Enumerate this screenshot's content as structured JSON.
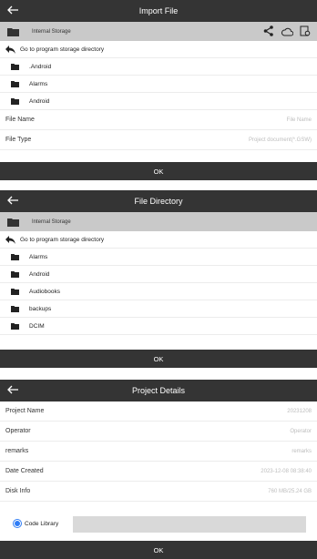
{
  "import_file": {
    "title": "Import File",
    "storage": "Internal Storage",
    "goto": "Go to program storage directory",
    "folders": [
      ".Android",
      "Alarms",
      "Android"
    ],
    "fields": [
      {
        "key": "File Name",
        "value": "File Name"
      },
      {
        "key": "File Type",
        "value": "Project document(*.GSW)"
      }
    ],
    "ok": "OK",
    "icons": [
      "back-arrow-icon",
      "folder-icon",
      "share-icon",
      "cloud-icon",
      "settings-file-icon",
      "goto-icon"
    ]
  },
  "file_directory": {
    "title": "File Directory",
    "storage": "Internal Storage",
    "goto": "Go to program storage directory",
    "folders": [
      "Alarms",
      "Android",
      "Audiobooks",
      "backups",
      "DCIM"
    ],
    "ok": "OK"
  },
  "project_details": {
    "title": "Project Details",
    "fields": [
      {
        "key": "Project Name",
        "value": "20231208"
      },
      {
        "key": "Operator",
        "value": "Operator"
      },
      {
        "key": "remarks",
        "value": "remarks"
      },
      {
        "key": "Date Created",
        "value": "2023-12-08 08:38:40"
      },
      {
        "key": "Disk Info",
        "value": "760 MB/25.24 GB"
      }
    ],
    "code_library_label": "Code Library",
    "ok": "OK"
  },
  "colors": {
    "dark_bar": "#343434",
    "storage_bar": "#c9c9c9",
    "accent": "#2f7df6"
  }
}
